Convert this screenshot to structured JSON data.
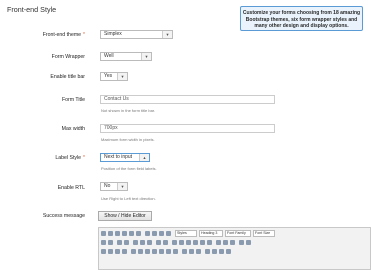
{
  "section_title": "Front-end Style",
  "callout": {
    "line1": "Customize your forms choosing from 18 amazing",
    "line2": "Bootstrap themes, six form wrapper styles and",
    "line3": "many other design and display options."
  },
  "fields": {
    "theme": {
      "label": "Front-end theme",
      "required_mark": "*",
      "value": "Simplex"
    },
    "wrapper": {
      "label": "Form Wrapper",
      "value": "Well"
    },
    "title_bar": {
      "label": "Enable title bar",
      "value": "Yes"
    },
    "form_title": {
      "label": "Form Title",
      "value": "Contact Us",
      "hint": "Not shown in the form title bar."
    },
    "max_width": {
      "label": "Max width",
      "value": "700px",
      "hint": "Maximum form width in pixels."
    },
    "label_style": {
      "label": "Label Style",
      "required_mark": "*",
      "value": "Next to input",
      "hint": "Position of the form field labels."
    },
    "rtl": {
      "label": "Enable RTL",
      "value": "No",
      "hint": "Use Right to Left text direction."
    },
    "success": {
      "label": "Success message",
      "button": "Show / Hide Editor"
    }
  },
  "editor_toolbar": {
    "styles": "Styles",
    "format": "Heading 3",
    "font": "Font Family",
    "size": "Font Size"
  }
}
